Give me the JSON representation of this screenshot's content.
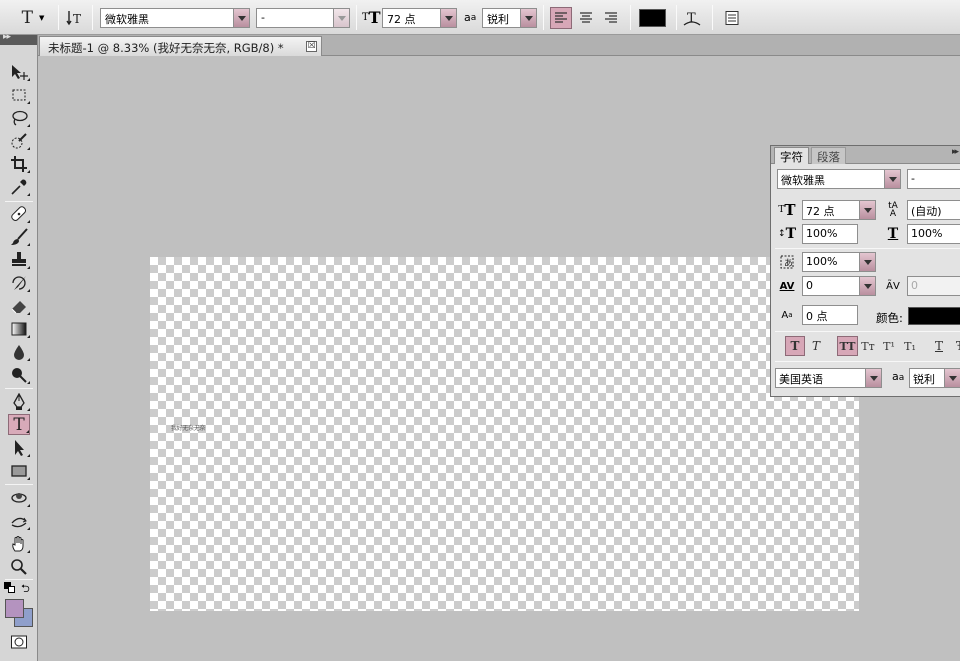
{
  "options_bar": {
    "font_family": "微软雅黑",
    "font_style": "-",
    "font_size": "72 点",
    "antialias": "锐利",
    "antialias_prefix": "a",
    "antialias_suffix": "a",
    "text_color": "#000000",
    "align_left_active": true
  },
  "document_tab": {
    "title": "未标题-1 @ 8.33% (我好无奈无奈, RGB/8) *",
    "close_label": "☒"
  },
  "canvas": {
    "text": "我好无奈无奈"
  },
  "character_panel": {
    "tabs": [
      "字符",
      "段落"
    ],
    "font_family": "微软雅黑",
    "font_style": "-",
    "font_size": "72 点",
    "leading": "(自动)",
    "vertical_scale": "100%",
    "horizontal_scale": "100%",
    "tsume": "100%",
    "tracking": "0",
    "kerning": "0",
    "baseline_shift": "0 点",
    "color_label": "颜色:",
    "color": "#000000",
    "language": "美国英语",
    "antialias": "锐利",
    "antialias_prefix": "a",
    "antialias_suffix": "a",
    "style_buttons": [
      {
        "label": "T",
        "name": "faux-bold"
      },
      {
        "label": "T",
        "name": "faux-italic"
      },
      {
        "label": "TT",
        "name": "all-caps"
      },
      {
        "label": "Tт",
        "name": "small-caps"
      },
      {
        "label": "T¹",
        "name": "superscript"
      },
      {
        "label": "T₁",
        "name": "subscript"
      },
      {
        "label": "T",
        "name": "underline"
      },
      {
        "label": "Ŧ",
        "name": "strikethrough"
      }
    ]
  },
  "colors": {
    "accent": "#d8aab9",
    "foreground_color": "#b493bf",
    "background_color": "#8f9fcb"
  }
}
